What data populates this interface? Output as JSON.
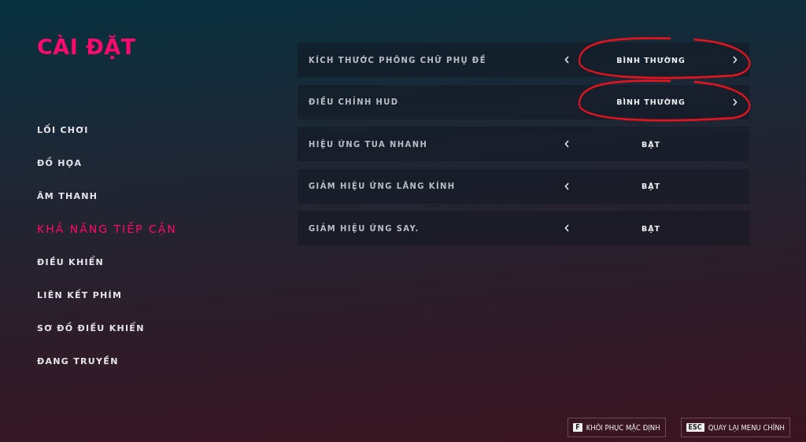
{
  "title": "CÀI ĐẶT",
  "menu": [
    {
      "label": "LỐI CHƠI",
      "selected": false
    },
    {
      "label": "ĐỒ HỌA",
      "selected": false
    },
    {
      "label": "ÂM THANH",
      "selected": false
    },
    {
      "label": "KHẢ NĂNG TIẾP CẬN",
      "selected": true
    },
    {
      "label": "ĐIỀU KHIỂN",
      "selected": false
    },
    {
      "label": "LIÊN KẾT PHÍM",
      "selected": false
    },
    {
      "label": "SƠ ĐỒ ĐIỀU KHIỂN",
      "selected": false
    },
    {
      "label": "ĐANG TRUYỀN",
      "selected": false
    }
  ],
  "settings": [
    {
      "label": "KÍCH THƯỚC PHÔNG CHỮ PHỤ ĐỀ",
      "value": "BÌNH THƯỜNG",
      "can_decrease": true,
      "can_increase": true,
      "circled": true
    },
    {
      "label": "ĐIỀU CHỈNH HUD",
      "value": "BÌNH THƯỜNG",
      "can_decrease": false,
      "can_increase": true,
      "circled": true
    },
    {
      "label": "HIỆU ỨNG TUA NHANH",
      "value": "BẬT",
      "can_decrease": true,
      "can_increase": false,
      "circled": false
    },
    {
      "label": "GIẢM HIỆU ỨNG LĂNG KÍNH",
      "value": "BẬT",
      "can_decrease": true,
      "can_increase": false,
      "circled": false
    },
    {
      "label": "GIẢM HIỆU ỨNG SAY.",
      "value": "BẬT",
      "can_decrease": true,
      "can_increase": false,
      "circled": false
    }
  ],
  "footer": [
    {
      "key": "F",
      "label": "KHÔI PHỤC MẶC ĐỊNH"
    },
    {
      "key": "ESC",
      "label": "QUAY LẠI MENU CHÍNH"
    }
  ]
}
